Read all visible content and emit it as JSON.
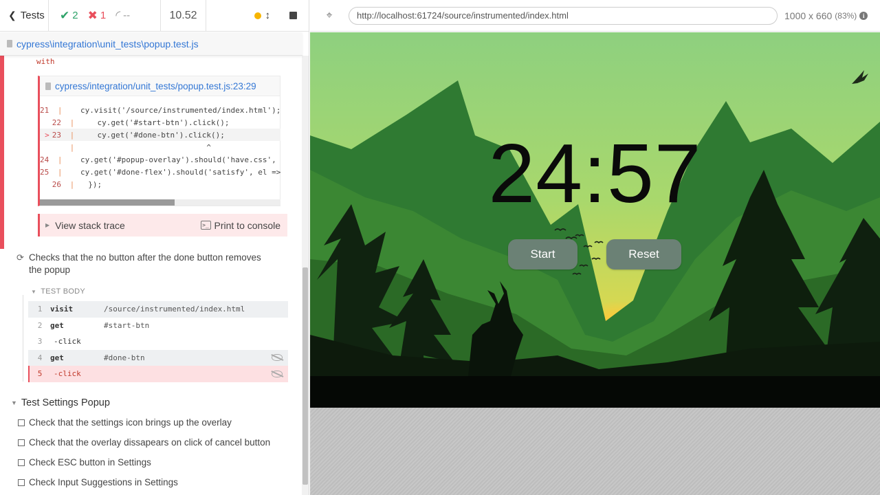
{
  "header": {
    "tests_label": "Tests",
    "passed_count": "2",
    "failed_count": "1",
    "pending_count": "--",
    "duration": "10.52"
  },
  "spec": {
    "path": "cypress\\integration\\unit_tests\\popup.test.js"
  },
  "error": {
    "with_text": "with",
    "code_frame_path": "cypress/integration/unit_tests/popup.test.js:23:29",
    "lines": [
      {
        "num": "21",
        "code": "    cy.visit('/source/instrumented/index.html');",
        "highlight": false,
        "arrow": false
      },
      {
        "num": "22",
        "code": "    cy.get('#start-btn').click();",
        "highlight": false,
        "arrow": false
      },
      {
        "num": "23",
        "code": "    cy.get('#done-btn').click();",
        "highlight": true,
        "arrow": true
      },
      {
        "num": "",
        "code": "                            ^",
        "highlight": false,
        "arrow": false
      },
      {
        "num": "24",
        "code": "    cy.get('#popup-overlay').should('have.css', 'display', 'block');",
        "highlight": false,
        "arrow": false
      },
      {
        "num": "25",
        "code": "    cy.get('#done-flex').should('satisfy', el => el);",
        "highlight": false,
        "arrow": false
      },
      {
        "num": "26",
        "code": "  });",
        "highlight": false,
        "arrow": false
      }
    ],
    "stack_trace_label": "View stack trace",
    "print_console_label": "Print to console"
  },
  "running_test": {
    "title": "Checks that the no button after the done button removes the popup"
  },
  "test_body": {
    "label": "TEST BODY",
    "commands": [
      {
        "num": "1",
        "name": "visit",
        "message": "/source/instrumented/index.html"
      },
      {
        "num": "2",
        "name": "get",
        "message": "#start-btn"
      },
      {
        "num": "3",
        "name": "-click",
        "message": ""
      },
      {
        "num": "4",
        "name": "get",
        "message": "#done-btn"
      },
      {
        "num": "5",
        "name": "-click",
        "message": ""
      }
    ]
  },
  "suite": {
    "title": "Test Settings Popup",
    "tests": [
      "Check that the settings icon brings up the overlay",
      "Check that the overlay dissapears on click of cancel button",
      "Check ESC button in Settings",
      "Check Input Suggestions in Settings"
    ]
  },
  "aut": {
    "url": "http://localhost:61724/source/instrumented/index.html",
    "viewport": "1000 x 660",
    "scale": "(83%)",
    "timer": "24:57",
    "start_label": "Start",
    "reset_label": "Reset"
  },
  "colors": {
    "fail": "#e94f5c",
    "pass": "#2fa36a",
    "link": "#3377d5",
    "button": "#6b8175"
  }
}
